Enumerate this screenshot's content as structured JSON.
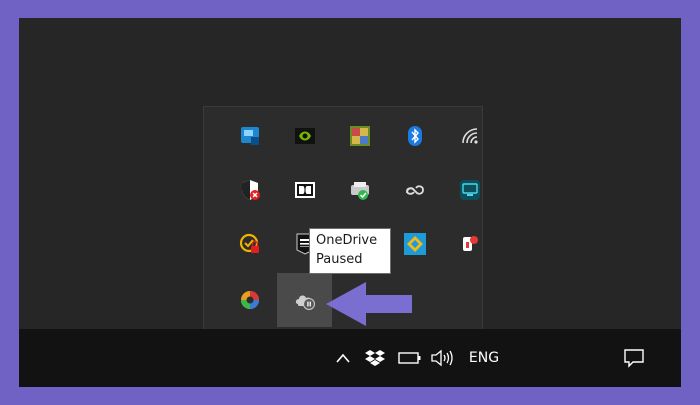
{
  "tooltip": {
    "line1": "OneDrive",
    "line2": "Paused"
  },
  "taskbar": {
    "language": "ENG"
  },
  "tray_icons": [
    "intel-graphics-icon",
    "nvidia-icon",
    "color-grid-icon",
    "bluetooth-icon",
    "network-wifi-icon",
    "security-shield-icon",
    "dolby-icon",
    "printer-check-icon",
    "creative-cloud-icon",
    "monitor-app-icon",
    "vpn-lock-icon",
    "epic-games-icon",
    "onedrive-hidden-icon",
    "blue-diamond-icon",
    "red-app-icon",
    "colorful-gear-icon",
    "onedrive-paused-icon"
  ],
  "colors": {
    "frame": "#6f62c4",
    "desktop": "#262626",
    "flyout": "#2c2c2c",
    "taskbar": "#121212",
    "arrow": "#7a6fd0"
  }
}
